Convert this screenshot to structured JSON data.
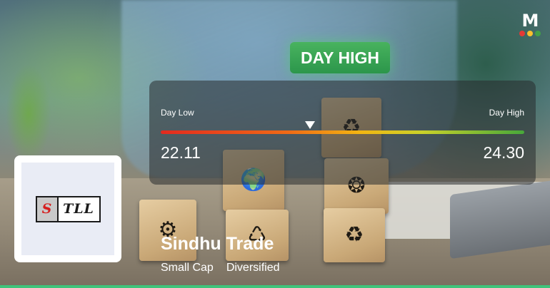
{
  "brand": {
    "logo_letter": "M",
    "dot_colors": [
      "#e53935",
      "#fbc02d",
      "#43a047"
    ]
  },
  "badge": {
    "label": "DAY HIGH",
    "color": "#3fb35a"
  },
  "range": {
    "low_label": "Day Low",
    "high_label": "Day High",
    "low_value": "22.11",
    "high_value": "24.30",
    "marker_fraction": 0.41
  },
  "company": {
    "logo_text_first": "S",
    "logo_text_rest": "TLL",
    "name": "Sindhu Trade",
    "tags": [
      "Small Cap",
      "Diversified"
    ]
  },
  "background_icons": [
    "recycle-globe-icon",
    "globe-hands-icon",
    "people-circle-icon",
    "leaf-gear-icon",
    "recycle-bin-icon",
    "eco-bag-icon"
  ],
  "accent_color": "#3fc47a"
}
